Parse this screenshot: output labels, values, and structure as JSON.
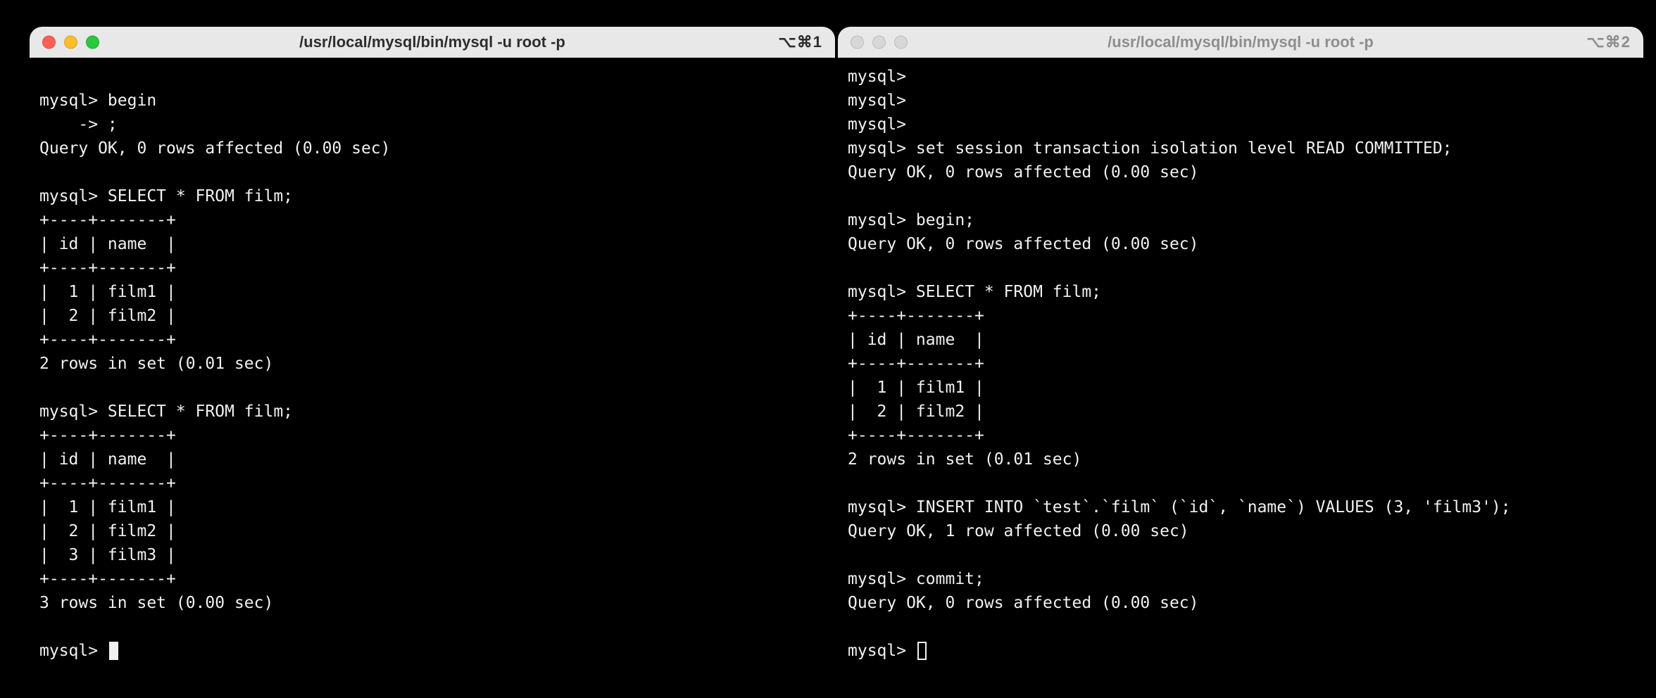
{
  "window1": {
    "title": "/usr/local/mysql/bin/mysql -u root -p",
    "shortcut": "⌥⌘1",
    "active": true,
    "lines": [
      "",
      "mysql> begin",
      "    -> ;",
      "Query OK, 0 rows affected (0.00 sec)",
      "",
      "mysql> SELECT * FROM film;",
      "+----+-------+",
      "| id | name  |",
      "+----+-------+",
      "|  1 | film1 |",
      "|  2 | film2 |",
      "+----+-------+",
      "2 rows in set (0.01 sec)",
      "",
      "mysql> SELECT * FROM film;",
      "+----+-------+",
      "| id | name  |",
      "+----+-------+",
      "|  1 | film1 |",
      "|  2 | film2 |",
      "|  3 | film3 |",
      "+----+-------+",
      "3 rows in set (0.00 sec)",
      ""
    ],
    "prompt": "mysql> "
  },
  "window2": {
    "title": "/usr/local/mysql/bin/mysql -u root -p",
    "shortcut": "⌥⌘2",
    "active": false,
    "lines": [
      "mysql>",
      "mysql>",
      "mysql>",
      "mysql> set session transaction isolation level READ COMMITTED;",
      "Query OK, 0 rows affected (0.00 sec)",
      "",
      "mysql> begin;",
      "Query OK, 0 rows affected (0.00 sec)",
      "",
      "mysql> SELECT * FROM film;",
      "+----+-------+",
      "| id | name  |",
      "+----+-------+",
      "|  1 | film1 |",
      "|  2 | film2 |",
      "+----+-------+",
      "2 rows in set (0.01 sec)",
      "",
      "mysql> INSERT INTO `test`.`film` (`id`, `name`) VALUES (3, 'film3');",
      "Query OK, 1 row affected (0.00 sec)",
      "",
      "mysql> commit;",
      "Query OK, 0 rows affected (0.00 sec)",
      ""
    ],
    "prompt": "mysql> "
  }
}
